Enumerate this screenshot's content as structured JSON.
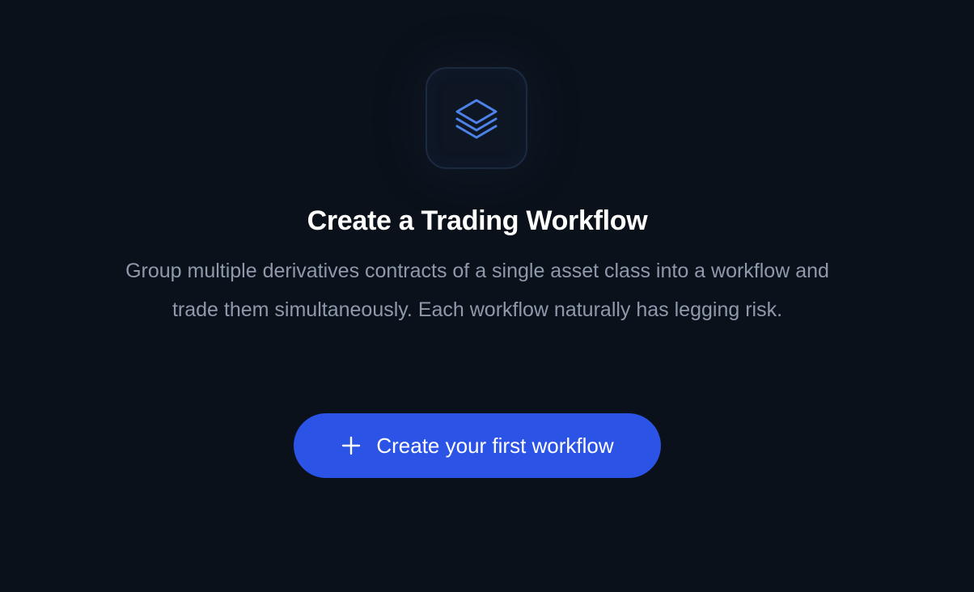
{
  "empty_state": {
    "icon": "layers-icon",
    "title": "Create a Trading Workflow",
    "description": "Group multiple derivatives contracts of a single asset class into a workflow and trade them simultaneously. Each workflow naturally has legging risk.",
    "cta": {
      "icon": "plus-icon",
      "label": "Create your first workflow"
    }
  },
  "colors": {
    "background": "#0b111a",
    "accent": "#2b53e6",
    "icon_stroke": "#4d82e8",
    "title": "#ffffff",
    "description": "#8e99ab"
  }
}
